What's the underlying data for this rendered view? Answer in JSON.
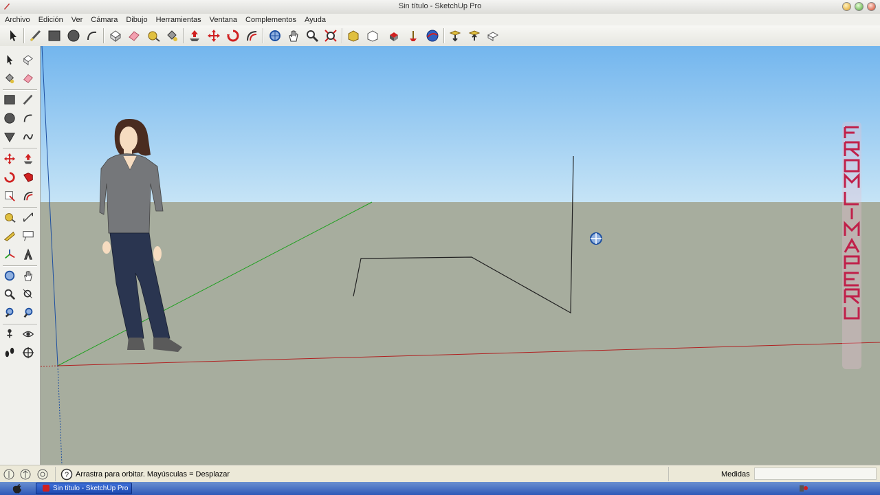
{
  "window": {
    "title": "Sin título - SketchUp Pro"
  },
  "menubar": {
    "items": [
      "Archivo",
      "Edición",
      "Ver",
      "Cámara",
      "Dibujo",
      "Herramientas",
      "Ventana",
      "Complementos",
      "Ayuda"
    ]
  },
  "toolbar": {
    "tools": [
      "select-icon",
      "line-icon",
      "rectangle-icon",
      "circle-icon",
      "arc-icon",
      "make-component-icon",
      "eraser-icon",
      "tape-measure-icon",
      "paint-bucket-icon",
      "push-pull-icon",
      "move-icon",
      "rotate-icon",
      "offset-icon",
      "orbit-icon",
      "pan-icon",
      "zoom-icon",
      "zoom-extents-icon",
      "get-models-icon",
      "share-model-icon",
      "share-component-icon",
      "extension-warehouse-icon",
      "send-to-layout-icon",
      "preview-icon",
      "photo-textures-icon",
      "add-location-icon",
      "toggle-terrain-icon"
    ]
  },
  "left_toolbar": {
    "tools": [
      "select-icon",
      "make-component-icon",
      "paint-bucket-icon",
      "eraser-icon",
      "rectangle-icon",
      "line-icon",
      "circle-icon",
      "arc-icon",
      "polygon-icon",
      "freehand-icon",
      "move-icon",
      "push-pull-icon",
      "rotate-icon",
      "follow-me-icon",
      "scale-icon",
      "offset-icon",
      "tape-measure-icon",
      "dimension-icon",
      "protractor-icon",
      "text-icon",
      "axes-icon",
      "3d-text-icon",
      "orbit-icon",
      "pan-icon",
      "zoom-icon",
      "zoom-window-icon",
      "previous-view-icon",
      "zoom-extents-icon",
      "position-camera-icon",
      "look-around-icon",
      "walk-icon",
      "section-plane-icon"
    ]
  },
  "viewport": {
    "sky_color": "#9fd0f2",
    "ground_color": "#a7ad9e",
    "watermark": "FROMLIMAPERU"
  },
  "statusbar": {
    "hint": "Arrastra para orbitar.  Mayúsculas = Desplazar",
    "measurements_label": "Medidas",
    "measurements_value": ""
  },
  "taskbar": {
    "task_label": "Sin título - SketchUp Pro"
  }
}
